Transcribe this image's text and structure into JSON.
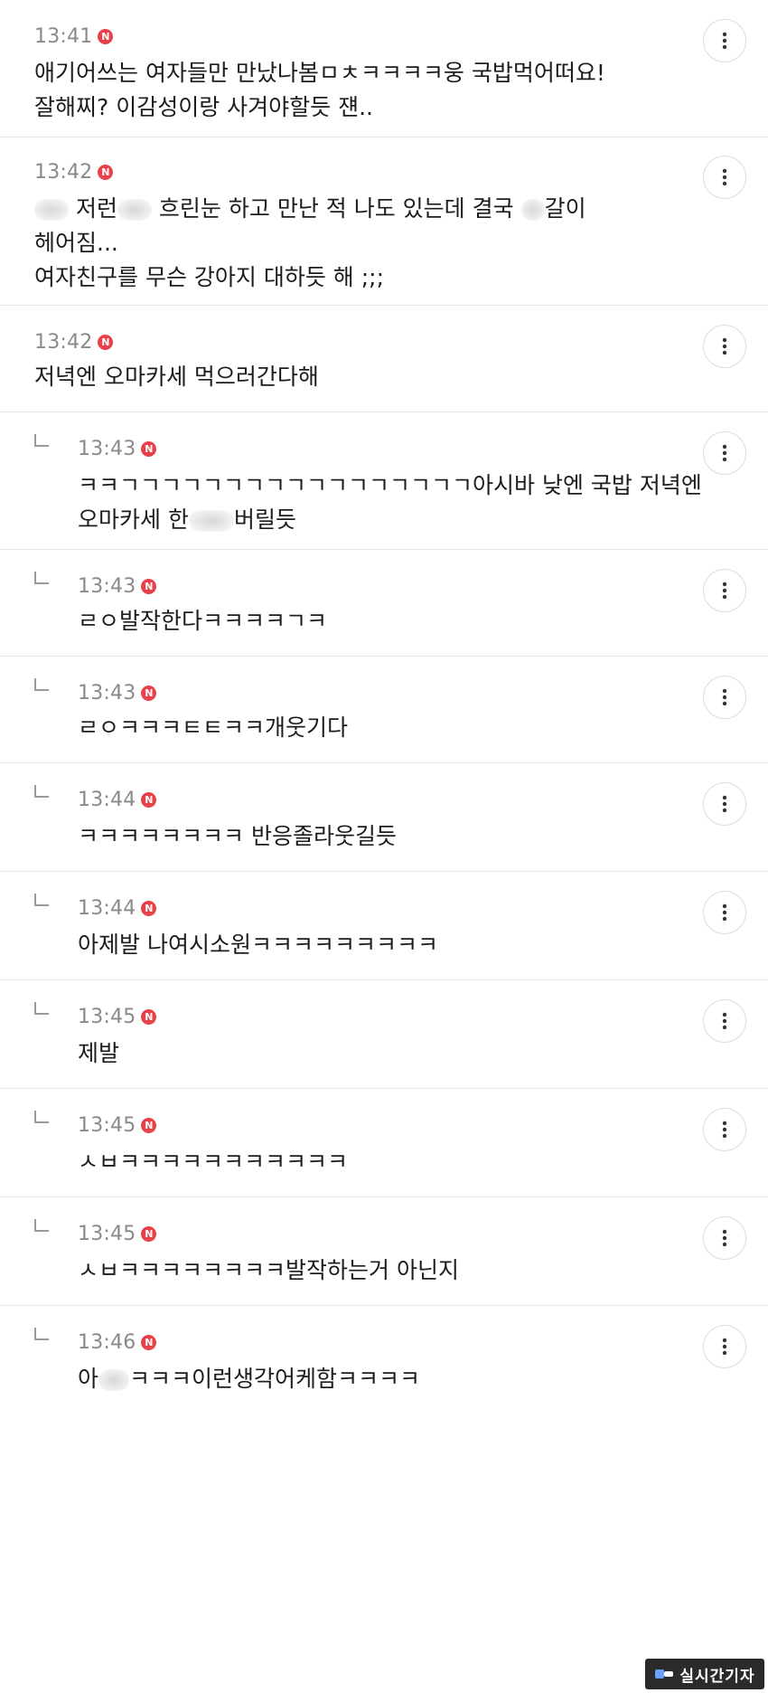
{
  "badge_letter": "N",
  "comments": [
    {
      "time": "13:41",
      "lines": [
        "애기어쓰는 여자들만 만났나봄ㅁㅊㅋㅋㅋㅋ웅 국밥먹어떠요!",
        "잘해찌? 이감성이랑 사겨야할듯 쟨.."
      ]
    },
    {
      "time": "13:42",
      "lines": [
        "저런",
        "흐린눈 하고 만난 적 나도 있는데 결국",
        "갈이",
        "헤어짐...",
        "여자친구를 무슨 강아지 대하듯 해 ;;;"
      ]
    },
    {
      "time": "13:42",
      "lines": [
        "저녁엔 오마카세 먹으러간다해"
      ]
    },
    {
      "time": "13:43",
      "lines": [
        "ㅋㅋㄱㄱㄱㄱㄱㄱㄱㄱㄱㄱㄱㄱㄱㄱㄱㄱㄱ아시바 낮엔 국밥 저녁엔",
        "오마카세 한",
        "버릴듯"
      ]
    },
    {
      "time": "13:43",
      "lines": [
        "ㄹㅇ발작한다ㅋㅋㅋㅋㄱㅋ"
      ]
    },
    {
      "time": "13:43",
      "lines": [
        "ㄹㅇㅋㅋㅋㅌㅌㅋㅋ개웃기다"
      ]
    },
    {
      "time": "13:44",
      "lines": [
        "ㅋㅋㅋㅋㅋㅋㅋㅋ 반응졸라웃길듯"
      ]
    },
    {
      "time": "13:44",
      "lines": [
        "아제발 나여시소원ㅋㅋㅋㅋㅋㅋㅋㅋㅋ"
      ]
    },
    {
      "time": "13:45",
      "lines": [
        "제발"
      ]
    },
    {
      "time": "13:45",
      "lines": [
        "ㅅㅂㅋㅋㅋㅋㅋㅋㅋㅋㅋㅋㅋ"
      ]
    },
    {
      "time": "13:45",
      "lines": [
        "ㅅㅂㅋㅋㅋㅋㅋㅋㅋㅋ발작하는거 아닌지"
      ]
    },
    {
      "time": "13:46",
      "lines": [
        "아",
        "ㅋㅋㅋ이런생각어케함ㅋㅋㅋㅋ"
      ]
    }
  ],
  "watermark": {
    "text": "실시간기자"
  },
  "icons": {
    "more": "more-vertical-icon",
    "reply": "reply-arrow-icon",
    "badge": "new-badge-icon"
  },
  "colors": {
    "badge": "#e8414a",
    "time": "#8a8a8a",
    "divider": "#e6e6e6"
  }
}
